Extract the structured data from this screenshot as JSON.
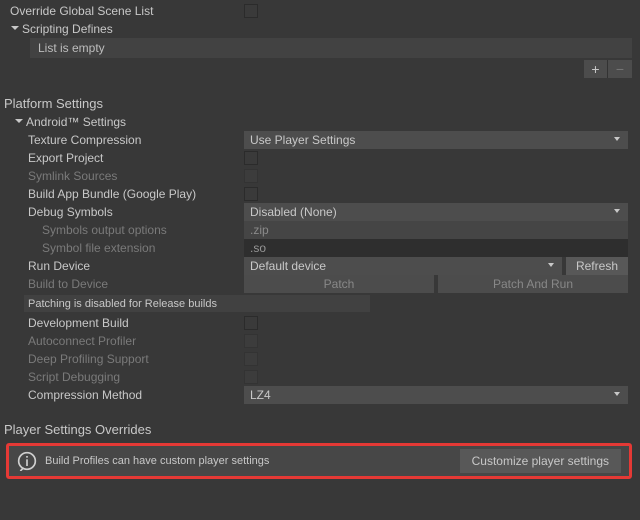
{
  "overrideGlobal": {
    "label": "Override Global Scene List"
  },
  "scriptingDefines": {
    "label": "Scripting Defines",
    "empty": "List is empty",
    "add": "+",
    "remove": "−"
  },
  "platformSettings": {
    "header": "Platform Settings",
    "android": {
      "label": "Android™ Settings",
      "items": {
        "textureCompression": {
          "label": "Texture Compression",
          "value": "Use Player Settings"
        },
        "exportProject": {
          "label": "Export Project"
        },
        "symlinkSources": {
          "label": "Symlink Sources"
        },
        "buildAppBundle": {
          "label": "Build App Bundle (Google Play)"
        },
        "debugSymbols": {
          "label": "Debug Symbols",
          "value": "Disabled (None)"
        },
        "symbolsOutput": {
          "label": "Symbols output options",
          "value": ".zip"
        },
        "symbolExt": {
          "label": "Symbol file extension",
          "value": ".so"
        },
        "runDevice": {
          "label": "Run Device",
          "value": "Default device",
          "refresh": "Refresh"
        },
        "buildToDevice": {
          "label": "Build to Device",
          "patch": "Patch",
          "patchRun": "Patch And Run"
        },
        "patchNote": "Patching is disabled for Release builds",
        "developmentBuild": {
          "label": "Development Build"
        },
        "autoconnectProfiler": {
          "label": "Autoconnect Profiler"
        },
        "deepProfiling": {
          "label": "Deep Profiling Support"
        },
        "scriptDebugging": {
          "label": "Script Debugging"
        },
        "compressionMethod": {
          "label": "Compression Method",
          "value": "LZ4"
        }
      }
    }
  },
  "playerOverrides": {
    "header": "Player Settings Overrides",
    "info": "Build Profiles can have custom player settings",
    "button": "Customize player settings"
  }
}
